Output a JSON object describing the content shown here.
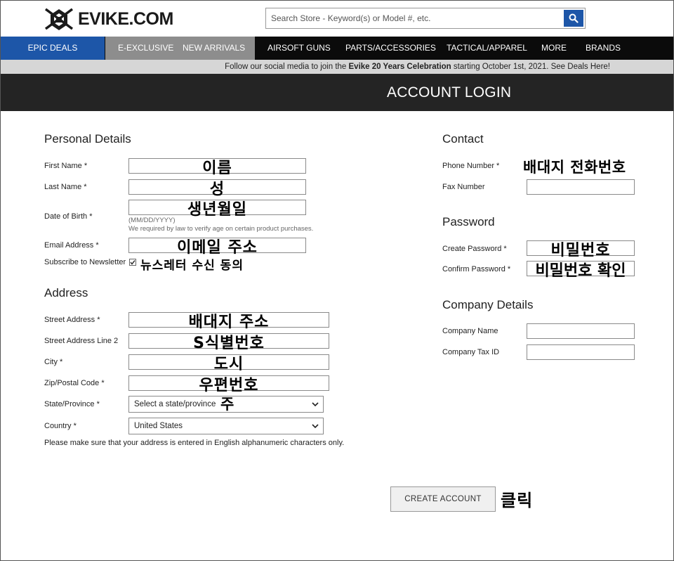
{
  "header": {
    "logo_text": "EVIKE.COM",
    "search_placeholder": "Search Store - Keyword(s) or Model #, etc."
  },
  "nav": {
    "items": [
      "EPIC DEALS",
      "E-EXCLUSIVE",
      "NEW ARRIVALS",
      "AIRSOFT GUNS",
      "PARTS/ACCESSORIES",
      "TACTICAL/APPAREL",
      "MORE",
      "BRANDS"
    ]
  },
  "promo": {
    "prefix": "Follow our social media to join the ",
    "highlight": "Evike 20 Years Celebration",
    "suffix": " starting October 1st, 2021. See Deals Here!"
  },
  "page_title": "ACCOUNT LOGIN",
  "personal": {
    "title": "Personal Details",
    "first_name": {
      "label": "First Name *",
      "value": "이름"
    },
    "last_name": {
      "label": "Last Name *",
      "value": "성"
    },
    "dob": {
      "label": "Date of Birth *",
      "value": "생년월일",
      "hint1": "(MM/DD/YYYY)",
      "hint2": "We required by law to verify age on certain product purchases."
    },
    "email": {
      "label": "Email Address *",
      "value": "이메일 주소"
    },
    "newsletter": {
      "label": "Subscribe to Newsletter",
      "annotation": "뉴스레터 수신 동의"
    }
  },
  "address": {
    "title": "Address",
    "street": {
      "label": "Street Address *",
      "value": "배대지 주소"
    },
    "street2": {
      "label": "Street Address Line 2",
      "value": "S식별번호"
    },
    "city": {
      "label": "City *",
      "value": "도시"
    },
    "zip": {
      "label": "Zip/Postal Code *",
      "value": "우편번호"
    },
    "state": {
      "label": "State/Province *",
      "selected": "Select a state/province",
      "annotation": "주"
    },
    "country": {
      "label": "Country *",
      "selected": "United States"
    },
    "note": "Please make sure that your address is entered in English alphanumeric characters only."
  },
  "contact": {
    "title": "Contact",
    "phone": {
      "label": "Phone Number *",
      "value": "배대지 전화번호"
    },
    "fax": {
      "label": "Fax Number",
      "value": ""
    }
  },
  "password": {
    "title": "Password",
    "create": {
      "label": "Create Password *",
      "value": "비밀번호"
    },
    "confirm": {
      "label": "Confirm Password *",
      "value": "비밀번호 확인"
    }
  },
  "company": {
    "title": "Company Details",
    "name": {
      "label": "Company Name",
      "value": ""
    },
    "tax": {
      "label": "Company Tax ID",
      "value": ""
    }
  },
  "submit": {
    "label": "CREATE ACCOUNT",
    "annotation": "클릭"
  },
  "colors": {
    "nav_blue": "#1d56a8",
    "nav_black": "#0b0b0b",
    "nav_grey": "#8d8d8d",
    "title_bar": "#242424"
  }
}
